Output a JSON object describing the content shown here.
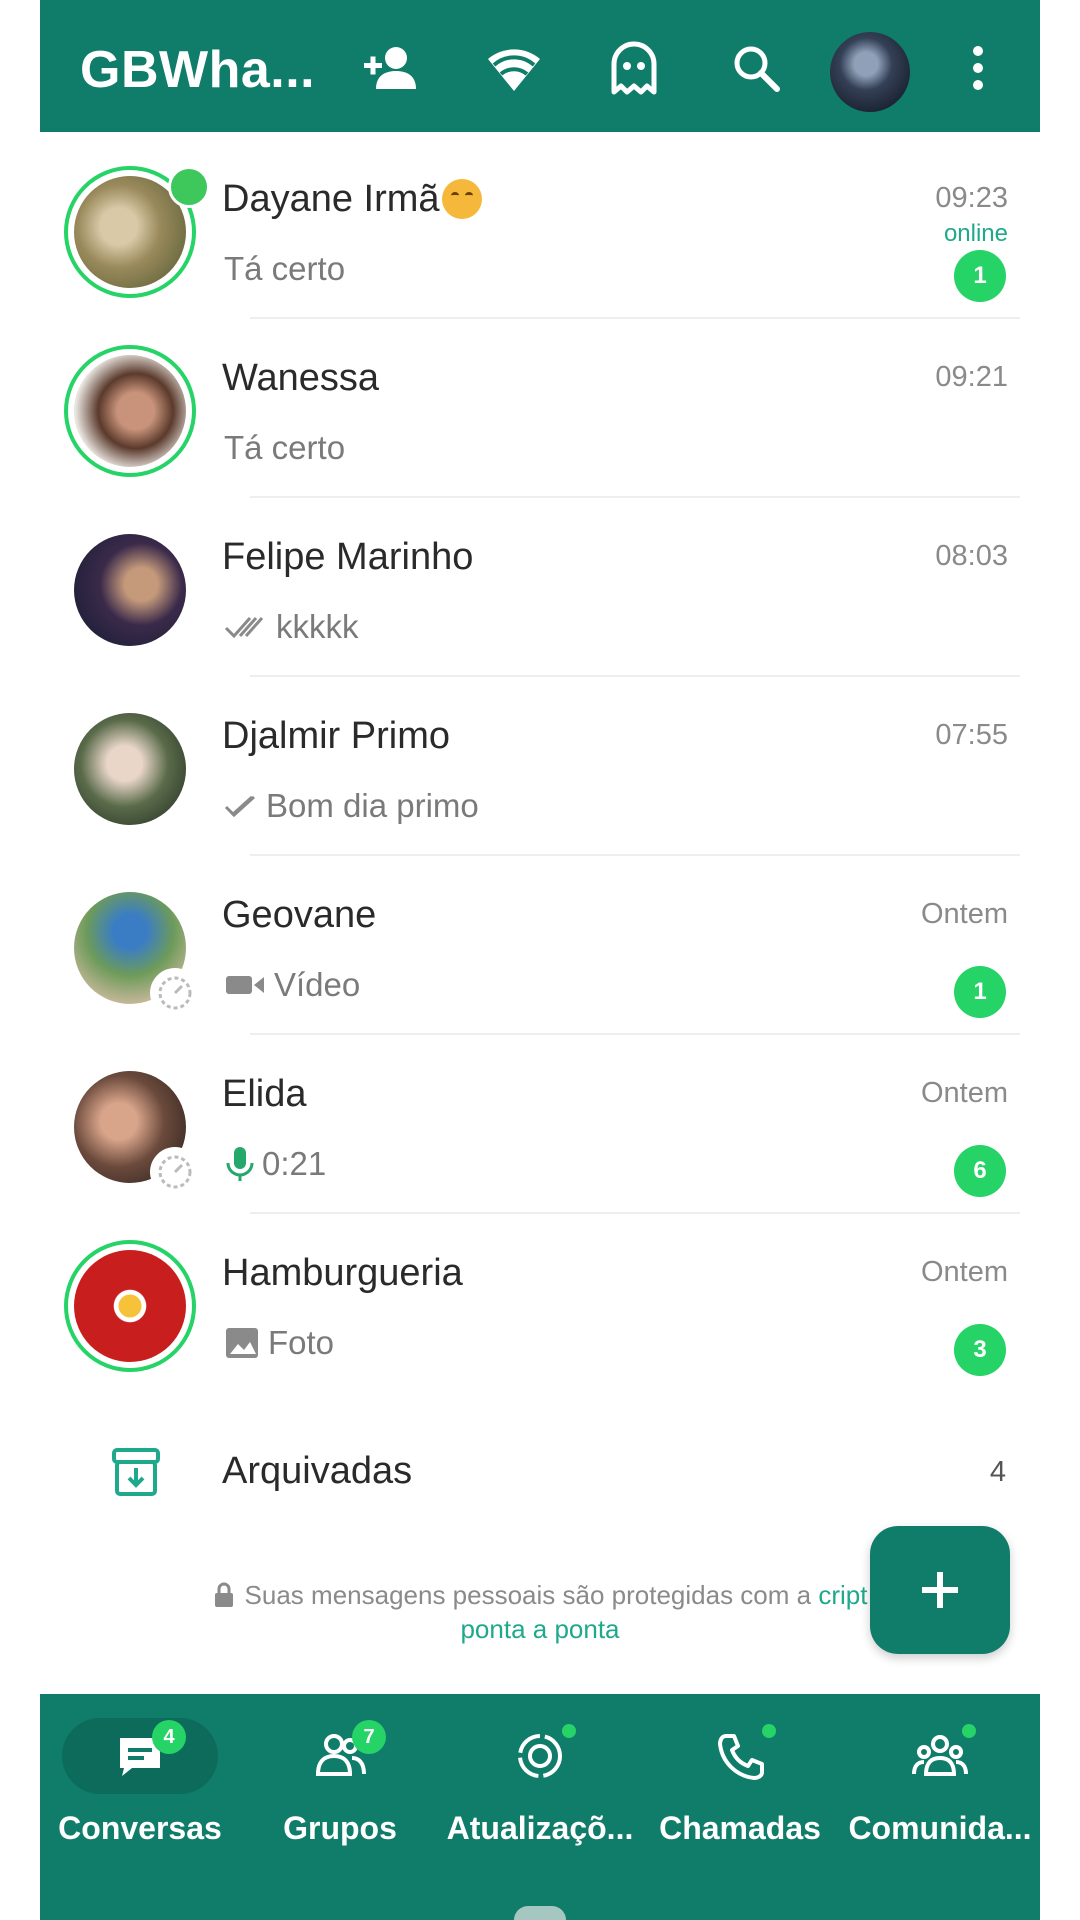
{
  "header": {
    "title": "GBWha...",
    "icons": [
      "add-contact-icon",
      "wifi-icon",
      "ghost-icon",
      "search-icon",
      "profile-avatar",
      "more-options-icon"
    ]
  },
  "chats": [
    {
      "name": "Dayane Irmã",
      "has_emoji": true,
      "preview": "Tá certo",
      "time": "09:23",
      "status_text": "online",
      "unread": "1"
    },
    {
      "name": "Wanessa",
      "preview": "Tá certo",
      "time": "09:21",
      "unread": ""
    },
    {
      "name": "Felipe Marinho",
      "preview": "kkkkk",
      "preview_icon": "double-check-icon",
      "time": "08:03",
      "unread": ""
    },
    {
      "name": "Djalmir Primo",
      "preview": "Bom dia primo",
      "preview_icon": "single-check-icon",
      "time": "07:55",
      "unread": ""
    },
    {
      "name": "Geovane",
      "preview": "Vídeo",
      "preview_icon": "video-icon",
      "time": "Ontem",
      "unread": "1"
    },
    {
      "name": "Elida",
      "preview": "0:21",
      "preview_icon": "microphone-icon",
      "time": "Ontem",
      "unread": "6"
    },
    {
      "name": "Hamburgueria",
      "preview": "Foto",
      "preview_icon": "photo-icon",
      "time": "Ontem",
      "unread": "3"
    }
  ],
  "archived": {
    "label": "Arquivadas",
    "count": "4"
  },
  "encryption_note": {
    "text": "Suas mensagens pessoais são protegidas com a ",
    "link": "cript",
    "link_line2": "ponta a ponta"
  },
  "fab": {
    "label": "+"
  },
  "bottom_nav": [
    {
      "label": "Conversas",
      "badge": "4",
      "active": true
    },
    {
      "label": "Grupos",
      "badge": "7"
    },
    {
      "label": "Atualizaçõ...",
      "dot": true
    },
    {
      "label": "Chamadas",
      "dot": true
    },
    {
      "label": "Comunida...",
      "dot": true
    }
  ],
  "colors": {
    "header_green": "#107d6a",
    "badge_green": "#25d366",
    "link_teal": "#1fa98c"
  }
}
